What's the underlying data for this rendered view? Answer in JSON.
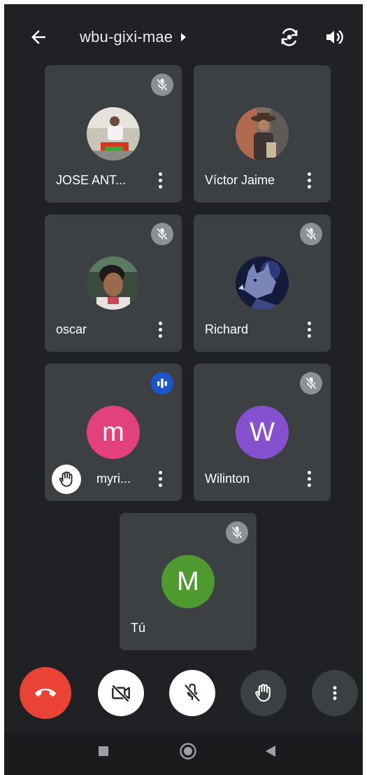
{
  "header": {
    "meeting_code": "wbu-gixi-mae"
  },
  "participants": [
    {
      "name": "JOSE ANT...",
      "mic": "muted",
      "avatar_type": "photo",
      "photo": "person-outdoors"
    },
    {
      "name": "Víctor Jaime",
      "mic": "muted",
      "avatar_type": "photo",
      "photo": "person-hat"
    },
    {
      "name": "oscar",
      "mic": "muted",
      "avatar_type": "photo",
      "photo": "person-selfie"
    },
    {
      "name": "Richard",
      "mic": "muted",
      "avatar_type": "photo",
      "photo": "wolf"
    },
    {
      "name": "myri...",
      "mic": "speaking",
      "avatar_type": "letter",
      "initial": "m",
      "color": "#e2417b",
      "hand_raised": true
    },
    {
      "name": "Wilinton",
      "mic": "muted",
      "avatar_type": "letter",
      "initial": "W",
      "color": "#8551cf"
    },
    {
      "name": "Tú",
      "mic": "muted",
      "avatar_type": "letter",
      "initial": "M",
      "color": "#4e9a2f"
    }
  ],
  "controls": [
    {
      "id": "end-call",
      "icon": "phone-hangup-icon",
      "bg": "#ea4335"
    },
    {
      "id": "camera-off",
      "icon": "video-off-icon",
      "bg": "#ffffff"
    },
    {
      "id": "mic-off",
      "icon": "mic-off-icon",
      "bg": "#ffffff"
    },
    {
      "id": "raise-hand",
      "icon": "hand-icon",
      "bg": "#3c4043"
    },
    {
      "id": "more-options",
      "icon": "more-vertical-icon",
      "bg": "#3c4043"
    }
  ],
  "colors": {
    "background": "#202124",
    "tile": "#3c4043",
    "muted_badge": "#8e9194",
    "speaking_badge": "#1a56c9"
  }
}
